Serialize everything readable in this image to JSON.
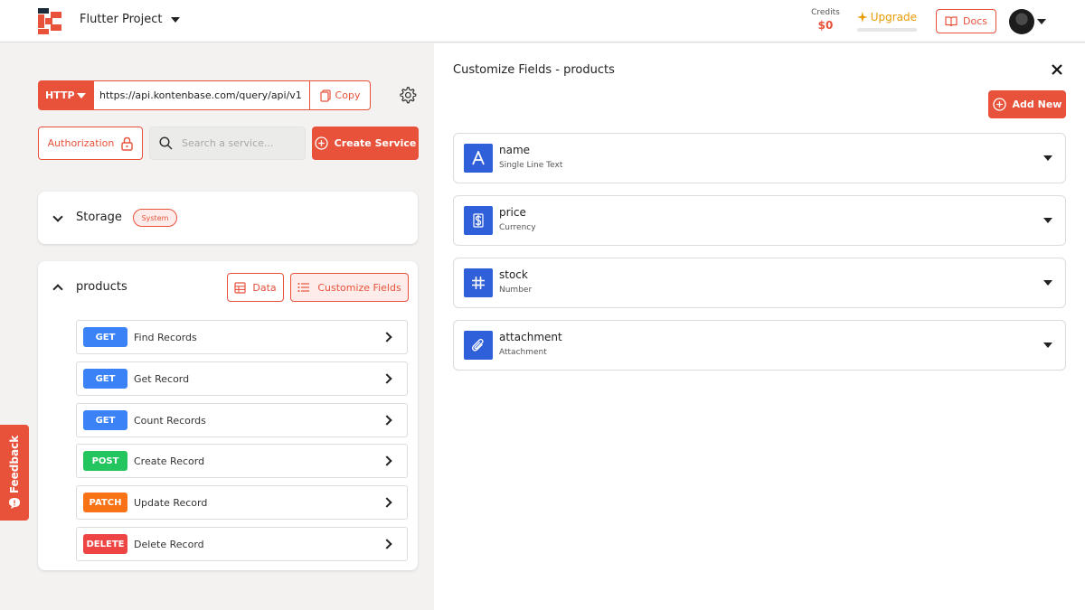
{
  "header": {
    "project_name": "Flutter Project",
    "credits_label": "Credits",
    "credits_value": "$0",
    "upgrade_label": "Upgrade",
    "docs_label": "Docs"
  },
  "request": {
    "method": "HTTP",
    "url": "https://api.kontenbase.com/query/api/v1",
    "copy_label": "Copy"
  },
  "toolbar": {
    "authorization_label": "Authorization",
    "search_placeholder": "Search a service...",
    "create_service_label": "Create Service"
  },
  "storage": {
    "title": "Storage",
    "badge": "System"
  },
  "products": {
    "title": "products",
    "data_label": "Data",
    "customize_label": "Customize Fields",
    "endpoints": [
      {
        "method": "GET",
        "label": "Find Records",
        "color": "#3b82f6"
      },
      {
        "method": "GET",
        "label": "Get Record",
        "color": "#3b82f6"
      },
      {
        "method": "GET",
        "label": "Count Records",
        "color": "#3b82f6"
      },
      {
        "method": "POST",
        "label": "Create Record",
        "color": "#22c55e"
      },
      {
        "method": "PATCH",
        "label": "Update Record",
        "color": "#f97316"
      },
      {
        "method": "DELETE",
        "label": "Delete Record",
        "color": "#ef4444"
      }
    ]
  },
  "panel": {
    "title": "Customize Fields - products",
    "add_new_label": "Add New",
    "fields": [
      {
        "name": "name",
        "type": "Single Line Text",
        "icon": "text-icon"
      },
      {
        "name": "price",
        "type": "Currency",
        "icon": "dollar-icon"
      },
      {
        "name": "stock",
        "type": "Number",
        "icon": "hash-icon"
      },
      {
        "name": "attachment",
        "type": "Attachment",
        "icon": "paperclip-icon"
      }
    ]
  },
  "feedback_label": "Feedback",
  "colors": {
    "brand": "#e8523b",
    "field_icon": "#2f5fd9",
    "upgrade": "#e69b00"
  }
}
